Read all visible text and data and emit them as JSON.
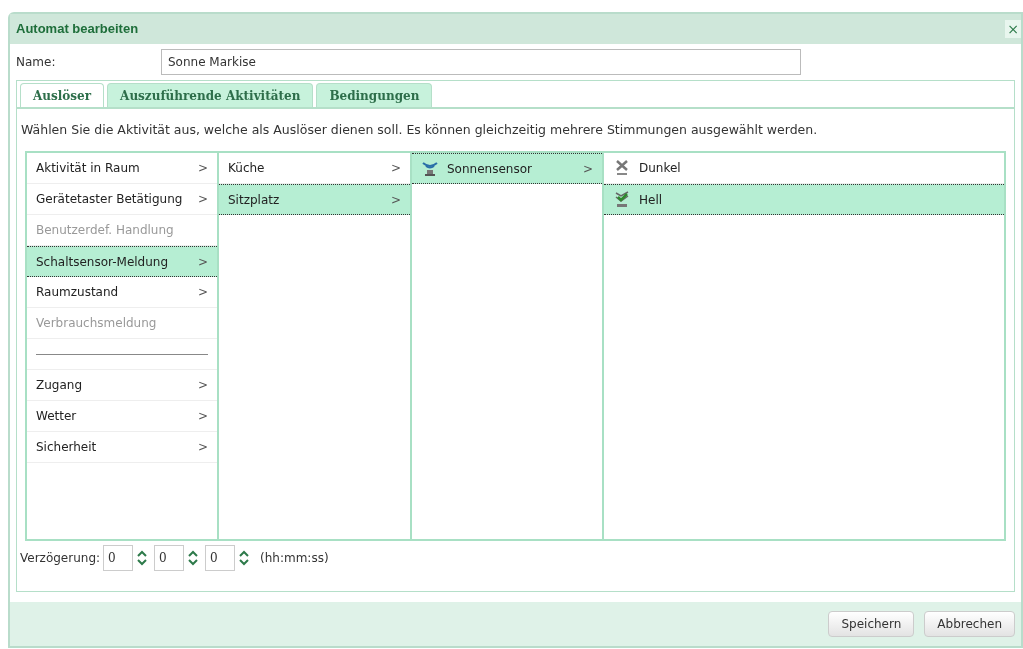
{
  "window": {
    "title": "Automat bearbeiten",
    "close": "×"
  },
  "name_field": {
    "label": "Name:",
    "value": "Sonne Markise"
  },
  "tabs": [
    {
      "label": "Auslöser",
      "selected": true
    },
    {
      "label": "Auszuführende Aktivitäten",
      "selected": false
    },
    {
      "label": "Bedingungen",
      "selected": false
    }
  ],
  "instruction": "Wählen Sie die Aktivität aus, welche als Auslöser dienen soll. Es können gleichzeitig mehrere Stimmungen ausgewählt werden.",
  "columns": [
    {
      "items": [
        {
          "kind": "item",
          "label": "Aktivität in Raum",
          "arrow": ">",
          "selected": false,
          "disabled": false
        },
        {
          "kind": "item",
          "label": "Gerätetaster Betätigung",
          "arrow": ">",
          "selected": false,
          "disabled": false
        },
        {
          "kind": "item",
          "label": "Benutzerdef. Handlung",
          "selected": false,
          "disabled": true
        },
        {
          "kind": "item",
          "label": "Schaltsensor-Meldung",
          "arrow": ">",
          "selected": true,
          "disabled": false
        },
        {
          "kind": "item",
          "label": "Raumzustand",
          "arrow": ">",
          "selected": false,
          "disabled": false
        },
        {
          "kind": "item",
          "label": "Verbrauchsmeldung",
          "selected": false,
          "disabled": true
        },
        {
          "kind": "separator"
        },
        {
          "kind": "item",
          "label": "Zugang",
          "arrow": ">",
          "selected": false,
          "disabled": false
        },
        {
          "kind": "item",
          "label": "Wetter",
          "arrow": ">",
          "selected": false,
          "disabled": false
        },
        {
          "kind": "item",
          "label": "Sicherheit",
          "arrow": ">",
          "selected": false,
          "disabled": false
        }
      ]
    },
    {
      "items": [
        {
          "kind": "item",
          "label": "Küche",
          "arrow": ">",
          "selected": false,
          "disabled": false
        },
        {
          "kind": "item",
          "label": "Sitzplatz",
          "arrow": ">",
          "selected": true,
          "disabled": false
        }
      ]
    },
    {
      "items": [
        {
          "kind": "sensor",
          "label": "Sonnensensor",
          "arrow": ">",
          "selected": true,
          "disabled": false
        }
      ]
    },
    {
      "items": [
        {
          "kind": "off",
          "label": "Dunkel",
          "selected": false,
          "disabled": false
        },
        {
          "kind": "on",
          "label": "Hell",
          "selected": true,
          "disabled": false
        }
      ]
    }
  ],
  "delay": {
    "label": "Verzögerung:",
    "fields": [
      {
        "value": "0"
      },
      {
        "value": "0"
      },
      {
        "value": "0"
      }
    ],
    "format": "(hh:mm:ss)"
  },
  "buttons": [
    {
      "label": "Speichern"
    },
    {
      "label": "Abbrechen"
    }
  ]
}
